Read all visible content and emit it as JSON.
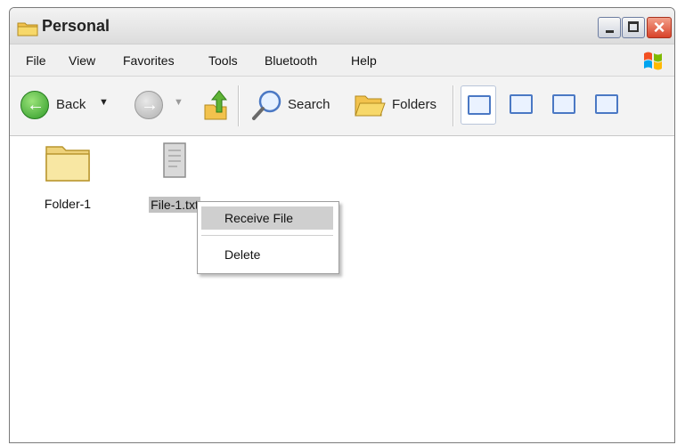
{
  "window": {
    "title": "Personal"
  },
  "menu": [
    "File",
    "View",
    "Favorites",
    "Tools",
    "Bluetooth",
    "Help"
  ],
  "toolbar": {
    "back_label": "Back",
    "search_label": "Search",
    "folders_label": "Folders"
  },
  "items": [
    {
      "name": "Folder-1",
      "icon": "folder-icon"
    },
    {
      "name": "File-1.txt",
      "icon": "text-file-icon",
      "selected": true
    }
  ],
  "context_menu": {
    "items": [
      "Receive File",
      "Delete"
    ],
    "highlighted": "Receive File"
  },
  "colors": {
    "accent": "#4a78c4",
    "close": "#d8432a",
    "selection": "#c2c2c2"
  }
}
